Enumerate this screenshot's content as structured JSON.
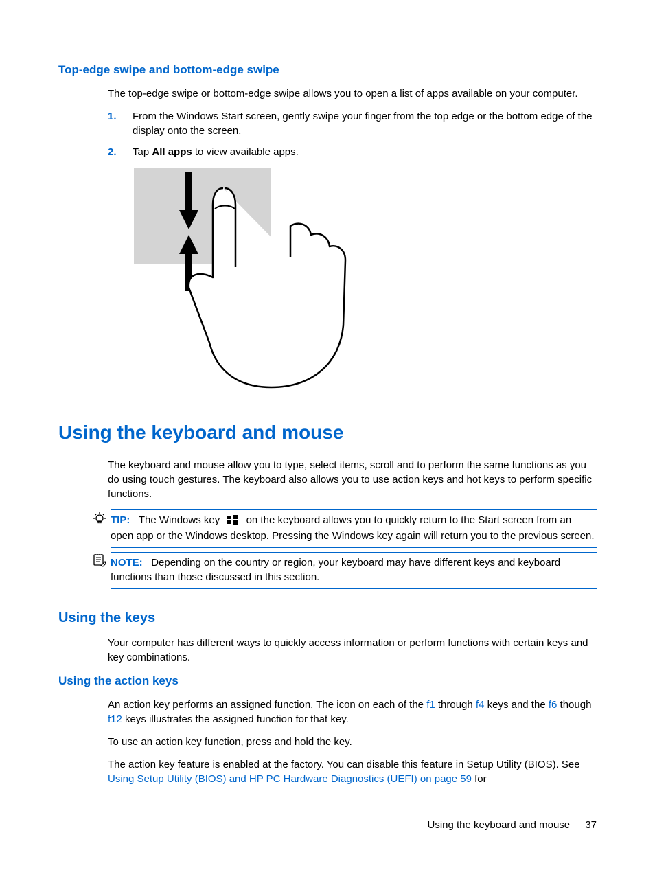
{
  "section1": {
    "heading": "Top-edge swipe and bottom-edge swipe",
    "intro": "The top-edge swipe or bottom-edge swipe allows you to open a list of apps available on your computer.",
    "steps": [
      {
        "num": "1.",
        "text": "From the Windows Start screen, gently swipe your finger from the top edge or the bottom edge of the display onto the screen."
      },
      {
        "num": "2.",
        "before": "Tap ",
        "bold": "All apps",
        "after": " to view available apps."
      }
    ]
  },
  "section2": {
    "heading": "Using the keyboard and mouse",
    "intro": "The keyboard and mouse allow you to type, select items, scroll and to perform the same functions as you do using touch gestures. The keyboard also allows you to use action keys and hot keys to perform specific functions.",
    "tip": {
      "label": "TIP:",
      "before": "The Windows key",
      "after": "on the keyboard allows you to quickly return to the Start screen from an open app or the Windows desktop. Pressing the Windows key again will return you to the previous screen."
    },
    "note": {
      "label": "NOTE:",
      "text": "Depending on the country or region, your keyboard may have different keys and keyboard functions than those discussed in this section."
    }
  },
  "section3": {
    "heading": "Using the keys",
    "intro": "Your computer has different ways to quickly access information or perform functions with certain keys and key combinations."
  },
  "section4": {
    "heading": "Using the action keys",
    "p1": {
      "a": "An action key performs an assigned function. The icon on each of the ",
      "k1": "f1",
      "b": " through ",
      "k2": "f4",
      "c": " keys and the ",
      "k3": "f6",
      "d": " though ",
      "k4": "f12",
      "e": " keys illustrates the assigned function for that key."
    },
    "p2": "To use an action key function, press and hold the key.",
    "p3": {
      "a": "The action key feature is enabled at the factory. You can disable this feature in Setup Utility (BIOS). See ",
      "link": "Using Setup Utility (BIOS) and HP PC Hardware Diagnostics (UEFI) on page 59",
      "b": " for"
    }
  },
  "footer": {
    "title": "Using the keyboard and mouse",
    "page": "37"
  }
}
